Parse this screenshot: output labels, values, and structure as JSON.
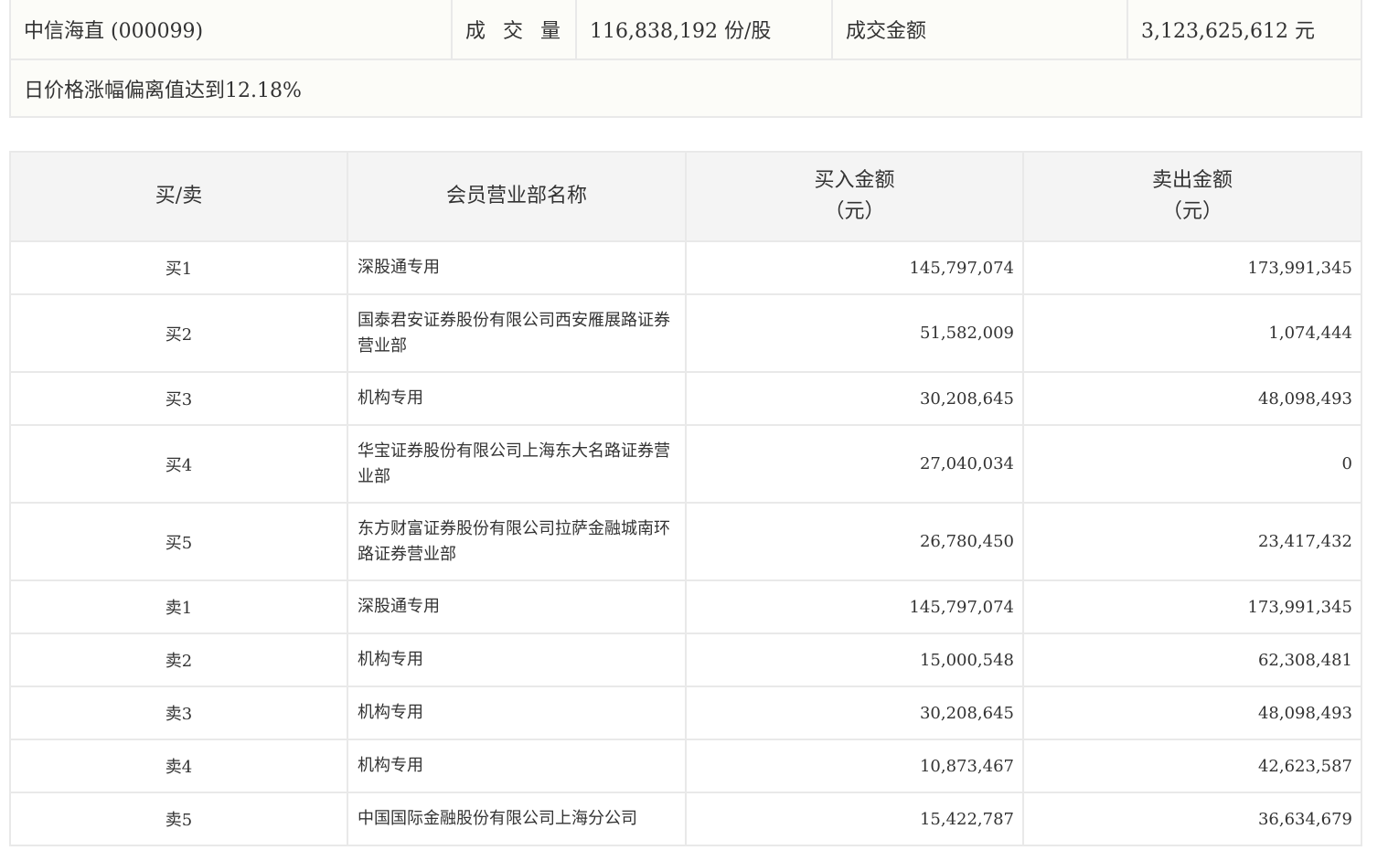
{
  "summary": {
    "stock_name": "中信海直 (000099)",
    "volume_label": "成 交 量",
    "volume_value": "116,838,192 份/股",
    "amount_label": "成交金额",
    "amount_value": "3,123,625,612 元",
    "reason": "日价格涨幅偏离值达到12.18%"
  },
  "table": {
    "headers": {
      "side": "买/卖",
      "member": "会员营业部名称",
      "buy_line1": "买入金额",
      "buy_line2": "（元）",
      "sell_line1": "卖出金额",
      "sell_line2": "（元）"
    },
    "rows": [
      {
        "side": "买1",
        "name": "深股通专用",
        "buy": "145,797,074",
        "sell": "173,991,345"
      },
      {
        "side": "买2",
        "name": "国泰君安证券股份有限公司西安雁展路证券营业部",
        "buy": "51,582,009",
        "sell": "1,074,444"
      },
      {
        "side": "买3",
        "name": "机构专用",
        "buy": "30,208,645",
        "sell": "48,098,493"
      },
      {
        "side": "买4",
        "name": "华宝证券股份有限公司上海东大名路证券营业部",
        "buy": "27,040,034",
        "sell": "0"
      },
      {
        "side": "买5",
        "name": "东方财富证券股份有限公司拉萨金融城南环路证券营业部",
        "buy": "26,780,450",
        "sell": "23,417,432"
      },
      {
        "side": "卖1",
        "name": "深股通专用",
        "buy": "145,797,074",
        "sell": "173,991,345"
      },
      {
        "side": "卖2",
        "name": "机构专用",
        "buy": "15,000,548",
        "sell": "62,308,481"
      },
      {
        "side": "卖3",
        "name": "机构专用",
        "buy": "30,208,645",
        "sell": "48,098,493"
      },
      {
        "side": "卖4",
        "name": "机构专用",
        "buy": "10,873,467",
        "sell": "42,623,587"
      },
      {
        "side": "卖5",
        "name": "中国国际金融股份有限公司上海分公司",
        "buy": "15,422,787",
        "sell": "36,634,679"
      }
    ]
  }
}
